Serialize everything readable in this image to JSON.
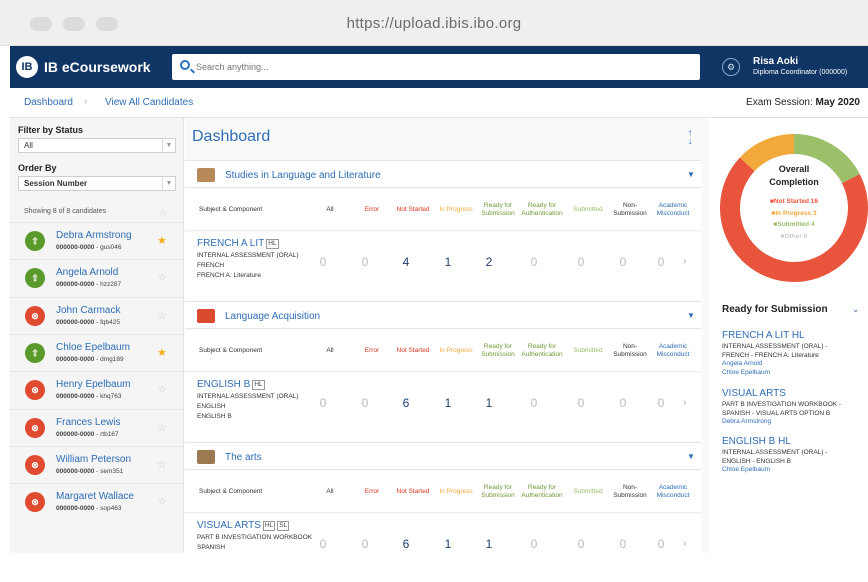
{
  "browser": {
    "url": "https://upload.ibis.ibo.org"
  },
  "header": {
    "app_name": "IB eCoursework",
    "search_placeholder": "Search anything...",
    "user_name": "Risa Aoki",
    "user_role": "Diploma Coordinator (000000)"
  },
  "breadcrumb": {
    "dashboard": "Dashboard",
    "view_all": "View All Candidates"
  },
  "exam_session": {
    "label": "Exam Session:",
    "value": "May 2020"
  },
  "sidebar": {
    "filter_label": "Filter by Status",
    "filter_value": "All",
    "order_label": "Order By",
    "order_value": "Session Number",
    "showing": "Showing 8 of 8 candidates",
    "candidates": [
      {
        "name": "Debra Armstrong",
        "num_bold": "000000-0000",
        "num_code": "- gus046",
        "status": "submitted",
        "starred": true
      },
      {
        "name": "Angela Arnold",
        "num_bold": "000000-0000",
        "num_code": "- hzz287",
        "status": "submitted",
        "starred": false
      },
      {
        "name": "John Carmack",
        "num_bold": "000000-0000",
        "num_code": "- fqb425",
        "status": "error",
        "starred": false
      },
      {
        "name": "Chloe Epelbaum",
        "num_bold": "000000-0000",
        "num_code": "- dmg189",
        "status": "submitted",
        "starred": true
      },
      {
        "name": "Henry Epelbaum",
        "num_bold": "000000-0000",
        "num_code": "- khq763",
        "status": "error",
        "starred": false
      },
      {
        "name": "Frances Lewis",
        "num_bold": "000000-0000",
        "num_code": "- rtb167",
        "status": "error",
        "starred": false
      },
      {
        "name": "William Peterson",
        "num_bold": "000000-0000",
        "num_code": "- sem351",
        "status": "error",
        "starred": false
      },
      {
        "name": "Margaret Wallace",
        "num_bold": "000000-0000",
        "num_code": "- sop463",
        "status": "error",
        "starred": false
      }
    ]
  },
  "main": {
    "title": "Dashboard",
    "columns": {
      "subject": "Subject & Component",
      "all": "All",
      "error": "Error",
      "not_started": "Not Started",
      "in_progress": "In Progress",
      "ready_sub_1": "Ready for",
      "ready_sub_2": "Submission",
      "ready_auth_1": "Ready for",
      "ready_auth_2": "Authentication",
      "submitted": "Submitted",
      "non_sub_1": "Non-",
      "non_sub_2": "Submission",
      "acad_1": "Academic",
      "acad_2": "Misconduct"
    },
    "sections": [
      {
        "title": "Studies in Language and Literature",
        "row": {
          "title": "FRENCH A LIT",
          "tags": [
            "HL"
          ],
          "lines": [
            "INTERNAL ASSESSMENT (ORAL)",
            "FRENCH",
            "FRENCH A: Literature"
          ],
          "values": [
            "0",
            "0",
            "4",
            "1",
            "2",
            "0",
            "0",
            "0",
            "0"
          ]
        }
      },
      {
        "title": "Language Acquisition",
        "row": {
          "title": "ENGLISH B",
          "tags": [
            "HL"
          ],
          "lines": [
            "INTERNAL ASSESSMENT (ORAL)",
            "ENGLISH",
            "ENGLISH B"
          ],
          "values": [
            "0",
            "0",
            "6",
            "1",
            "1",
            "0",
            "0",
            "0",
            "0"
          ]
        }
      },
      {
        "title": "The arts",
        "row": {
          "title": "VISUAL ARTS",
          "tags": [
            "HL",
            "SL"
          ],
          "lines": [
            "PART B INVESTIGATION WORKBOOK",
            "SPANISH"
          ],
          "values": [
            "0",
            "0",
            "6",
            "1",
            "1",
            "0",
            "0",
            "0",
            "0"
          ]
        }
      }
    ]
  },
  "completion": {
    "title_1": "Overall",
    "title_2": "Completion",
    "legend": [
      {
        "label": "Not Started",
        "value": 16,
        "color": "#e8553c"
      },
      {
        "label": "In Progress",
        "value": 3,
        "color": "#f0a93a"
      },
      {
        "label": "Submitted",
        "value": 4,
        "color": "#9cc06a"
      },
      {
        "label": "Other",
        "value": 0,
        "color": "#cccccc"
      }
    ]
  },
  "ready_for_submission": {
    "title": "Ready for Submission",
    "items": [
      {
        "head": "FRENCH A LIT HL",
        "lines": [
          "INTERNAL ASSESSMENT (ORAL) -",
          "FRENCH - FRENCH A: Literature"
        ],
        "people": [
          "Angela Arnold",
          "Chloe Epelbaum"
        ]
      },
      {
        "head": "VISUAL ARTS",
        "lines": [
          "PART B INVESTIGATION WORKBOOK -",
          "SPANISH - VISUAL ARTS OPTION B"
        ],
        "people": [
          "Debra Armstrong"
        ]
      },
      {
        "head": "ENGLISH B HL",
        "lines": [
          "INTERNAL ASSESSMENT (ORAL) -",
          "ENGLISH - ENGLISH B"
        ],
        "people": [
          "Chloe Epelbaum"
        ]
      }
    ]
  }
}
